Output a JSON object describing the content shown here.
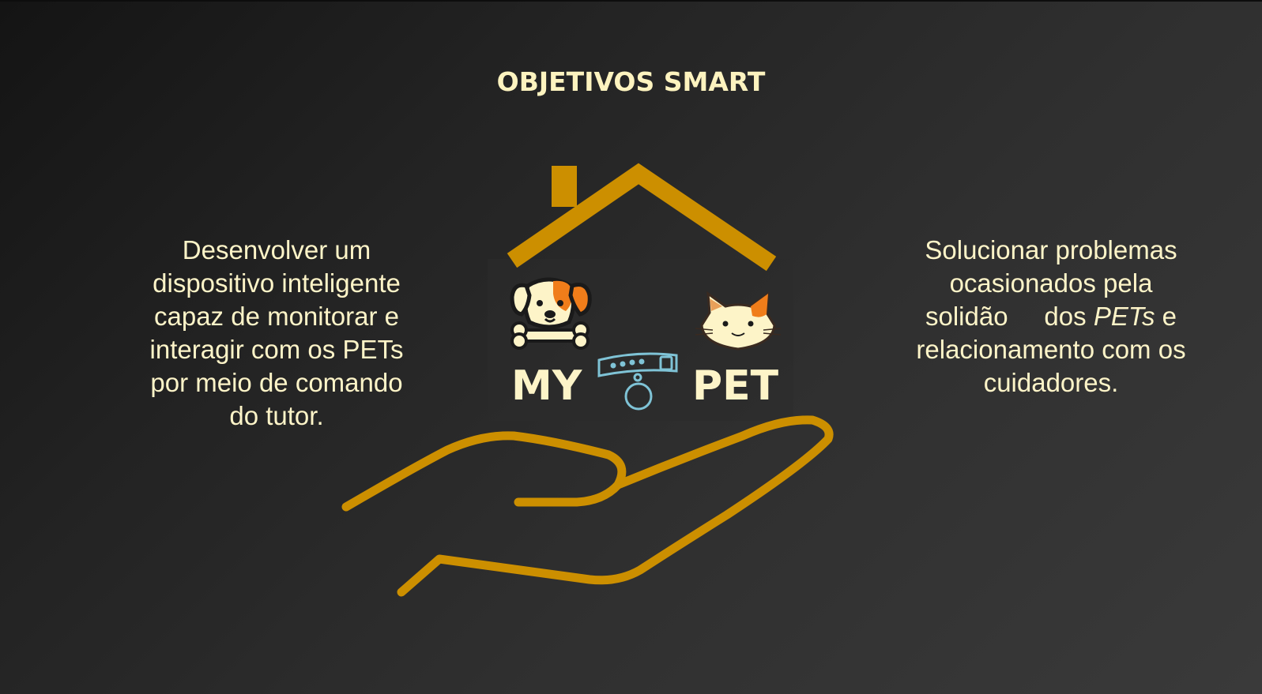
{
  "slide": {
    "title": "OBJETIVOS SMART"
  },
  "left_text": {
    "lines": [
      "Desenvolver um",
      "dispositivo inteligente",
      "capaz de monitorar e",
      "interagir com os PETs",
      "por meio de comando",
      "do tutor."
    ]
  },
  "right_text": {
    "line1": "Solucionar problemas",
    "line2": "ocasionados pela",
    "line3_a": "solidão",
    "line3_b": "dos",
    "line3_em": "PETs",
    "line3_c": "e",
    "line4": "relacionamento com os",
    "line5": "cuidadores."
  },
  "logo": {
    "word_left": "MY",
    "word_right": "PET",
    "colors": {
      "gold": "#cc8f00",
      "cream": "#fdf4c8",
      "orange": "#f07d1a",
      "collar": "#7fc3d6"
    },
    "icons": [
      "house-roof-icon",
      "dog-icon",
      "collar-icon",
      "cat-icon",
      "hand-icon"
    ]
  },
  "colors": {
    "background": "#2a2a2a",
    "text": "#fdf4c8"
  }
}
